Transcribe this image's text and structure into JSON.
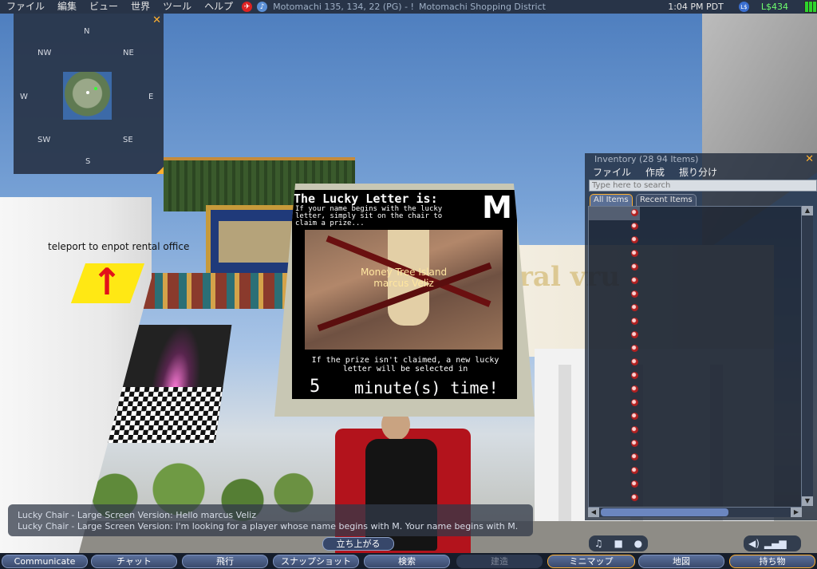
{
  "menubar": {
    "items": [
      "ファイル",
      "編集",
      "ビュー",
      "世界",
      "ツール",
      "ヘルプ"
    ],
    "location": "Motomachi 135, 134, 22 (PG) - !",
    "region": "Motomachi Shopping District",
    "time": "1:04 PM PDT",
    "currency_icon": "L$",
    "money": "L$434"
  },
  "minimap": {
    "directions": {
      "n": "N",
      "nw": "NW",
      "ne": "NE",
      "w": "W",
      "e": "E",
      "sw": "SW",
      "se": "SE",
      "s": "S"
    },
    "close": "✕"
  },
  "scene": {
    "teleport_text": "teleport to enpot rental office",
    "arrow": "↑"
  },
  "lucky": {
    "title": "The Lucky Letter is:",
    "letter": "M",
    "instruction": "If your name begins with the lucky letter, simply sit on the chair to claim a prize...",
    "hover_line1": "Money Tree Island",
    "hover_line2": "marcus Veliz",
    "note": "If the prize isn't claimed, a new lucky letter will be selected in",
    "count": "5",
    "time_label": "minute(s) time!"
  },
  "inventory": {
    "title": "Inventory (28 94  Items)",
    "close": "✕",
    "menu": [
      "ファイル",
      "作成",
      "振り分け"
    ],
    "search_placeholder": "Type here to search",
    "tabs": {
      "all": "All Items",
      "recent": "Recent Items"
    },
    "row_count": 22
  },
  "chat": {
    "lines": [
      "Lucky Chair - Large Screen Version: Hello marcus Veliz",
      "Lucky Chair - Large Screen Version: I'm looking for a player whose name begins with M. Your name begins with M."
    ]
  },
  "stand_up": "立ち上がる",
  "toolbar": {
    "communicate": "Communicate",
    "chat": "チャット",
    "fly": "飛行",
    "snapshot": "スナップショット",
    "search": "検索",
    "build": "建造",
    "minimap": "ミニマップ",
    "map": "地図",
    "inventory": "持ち物"
  },
  "colors": {
    "accent": "#ffb030",
    "panel": "#283448",
    "money": "#6fff6f"
  }
}
